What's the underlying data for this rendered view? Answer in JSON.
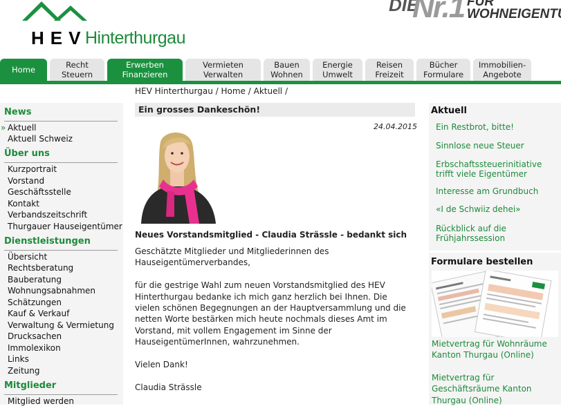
{
  "header": {
    "logo_text": "HEV",
    "logo_region": "Hinterthurgau",
    "slogan_die": "DIE",
    "slogan_nr": "Nr.1",
    "slogan_fuer": "FÜR",
    "slogan_rest": "WOHNEIGENTUM"
  },
  "nav": {
    "tabs": [
      {
        "label": "Home",
        "active": true
      },
      {
        "label": "Recht\nSteuern"
      },
      {
        "label": "Erwerben\nFinanzieren",
        "highlight": true
      },
      {
        "label": "Vermieten\nVerwalten"
      },
      {
        "label": "Bauen\nWohnen"
      },
      {
        "label": "Energie\nUmwelt"
      },
      {
        "label": "Reisen\nFreizeit"
      },
      {
        "label": "Bücher\nFormulare"
      },
      {
        "label": "Immobilien-\nAngebote"
      }
    ]
  },
  "breadcrumb": "HEV Hinterthurgau / Home / Aktuell /",
  "sidebar": {
    "news_title": "News",
    "news_items": [
      "Aktuell",
      "Aktuell Schweiz"
    ],
    "about_title": "Über uns",
    "about_items": [
      "Kurzportrait",
      "Vorstand",
      "Geschäftsstelle",
      "Kontakt",
      "Verbandszeitschrift",
      "Thurgauer Hauseigentümer"
    ],
    "services_title": "Dienstleistungen",
    "services_items": [
      "Übersicht",
      "Rechtsberatung",
      "Bauberatung",
      "Wohnungsabnahmen",
      "Schätzungen",
      "Kauf & Verkauf",
      "Verwaltung & Vermietung",
      "Drucksachen",
      "Immolexikon",
      "Links",
      "Zeitung"
    ],
    "members_title": "Mitglieder",
    "members_items": [
      "Mitglied werden"
    ]
  },
  "article": {
    "title": "Ein grosses Dankeschön!",
    "date": "24.04.2015",
    "subheading": "Neues Vorstandsmitglied - Claudia Strässle - bedankt sich",
    "paragraphs": [
      "Geschätzte Mitglieder und Mitgliederinnen des Hauseigentümerverbandes,",
      "für die gestrige Wahl zum neuen Vorstandsmitglied des HEV Hinterthurgau bedanke ich mich ganz herzlich bei Ihnen. Die vielen schönen Begegnungen an der Hauptversammlung und die netten Worte bestärken mich heute nochmals dieses Amt im Vorstand, mit vollem Engagement im Sinne der HauseigentümerInnen, wahrzunehmen.",
      "Vielen Dank!",
      "Claudia Strässle"
    ]
  },
  "right": {
    "aktuell_title": "Aktuell",
    "aktuell_links": [
      "Ein Restbrot, bitte!",
      "Sinnlose neue Steuer",
      "Erbschaftssteuerinitiative trifft viele Eigentümer",
      "Interesse am Grundbuch",
      "«I de Schwiiz dehei»",
      "Rückblick auf die Frühjahrssession"
    ],
    "forms_title": "Formulare bestellen",
    "forms_links": [
      "Mietvertrag für Wohnräume Kanton Thurgau (Online)",
      "Mietvertrag für Geschäftsräume Kanton Thurgau (Online)"
    ]
  },
  "colors": {
    "brand_green": "#1b9140",
    "link_green": "#1d8a3a",
    "pink_scarf": "#e8318f"
  }
}
